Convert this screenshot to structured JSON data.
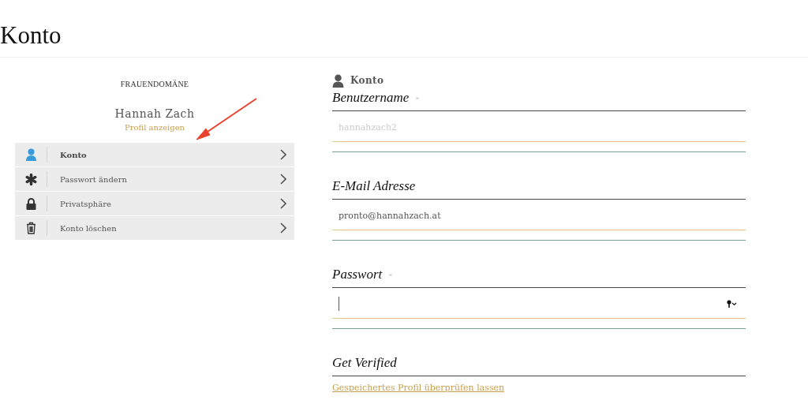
{
  "page_title": "Konto",
  "profile": {
    "brand": "FRAUENDOMÄNE",
    "name": "Hannah Zach",
    "link": "Profil anzeigen"
  },
  "menu": [
    {
      "label": "Konto",
      "kind": "person",
      "selected": true
    },
    {
      "label": "Passwort ändern",
      "kind": "asterisk",
      "selected": false
    },
    {
      "label": "Privatsphäre",
      "kind": "lock",
      "selected": false
    },
    {
      "label": "Konto löschen",
      "kind": "trash",
      "selected": false
    }
  ],
  "section": {
    "title": "Konto"
  },
  "fields": [
    {
      "label": "Benutzername",
      "required_mark": "*",
      "placeholder": "hannahzach2",
      "kind": "text"
    },
    {
      "label": "E-Mail Adresse",
      "value": "pronto@hannahzach.at",
      "kind": "text"
    },
    {
      "label": "Passwort",
      "required_mark": "*",
      "kind": "password"
    }
  ],
  "verify": {
    "title": "Get Verified",
    "link": "Gespeichertes Profil überprüfen lassen"
  }
}
